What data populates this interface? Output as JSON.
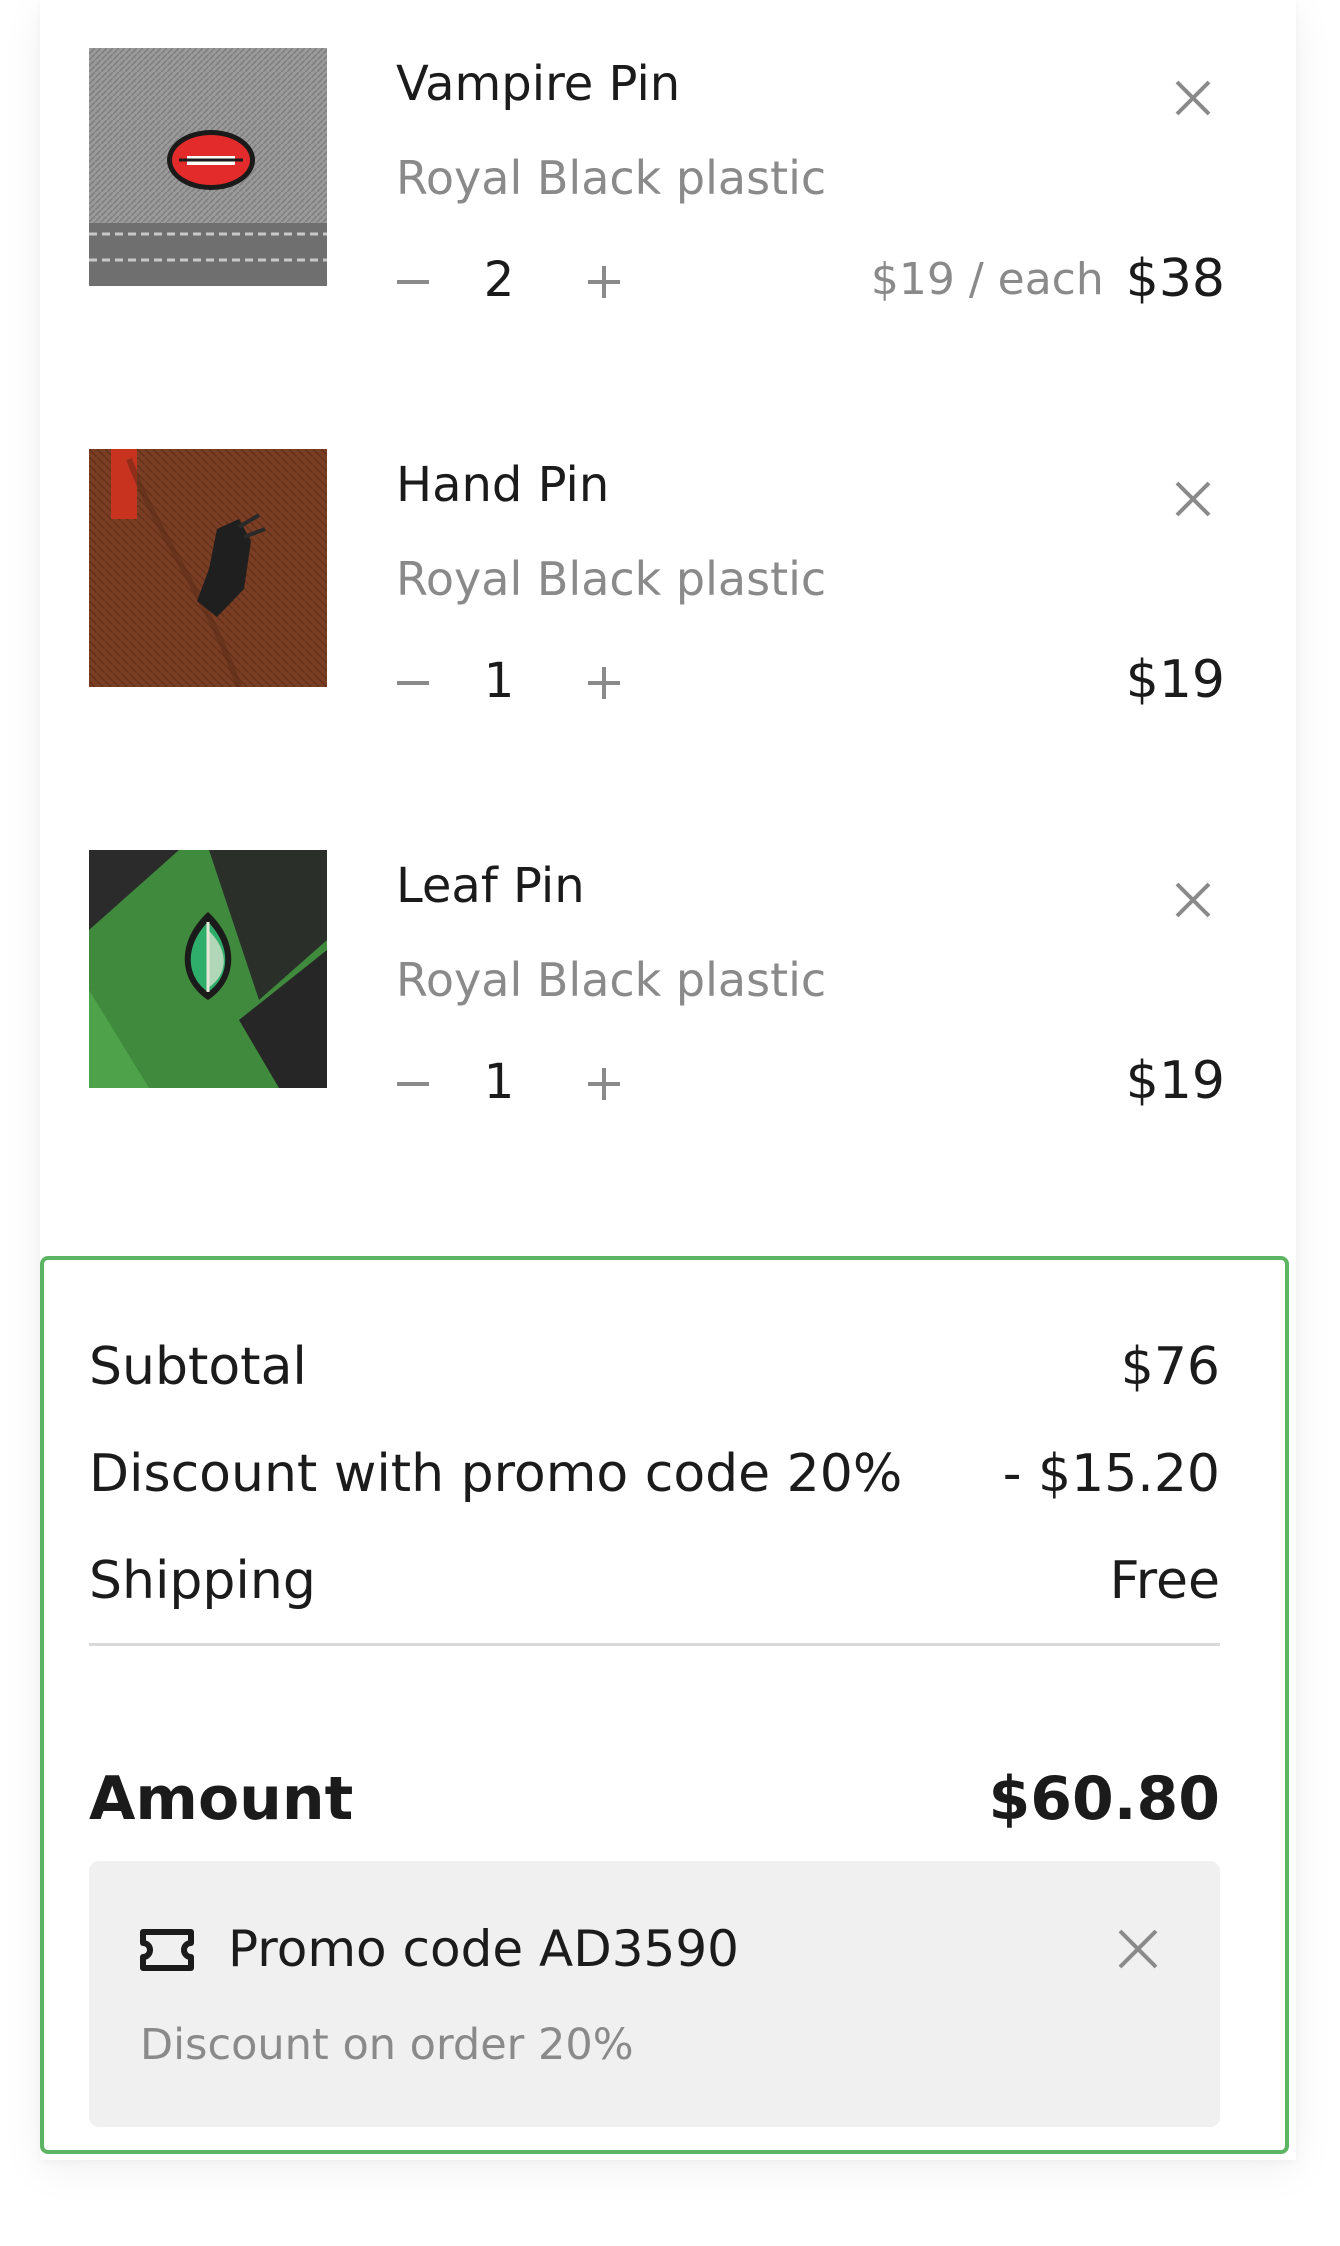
{
  "cart": {
    "items": [
      {
        "name": "Vampire Pin",
        "material": "Royal Black plastic",
        "quantity": "2",
        "unit_price": "$19 / each",
        "total": "$38",
        "image": "vampire-lips-pin-on-denim"
      },
      {
        "name": "Hand Pin",
        "material": "Royal Black plastic",
        "quantity": "1",
        "unit_price": "",
        "total": "$19",
        "image": "hand-pin-on-brown-fabric"
      },
      {
        "name": "Leaf Pin",
        "material": "Royal Black plastic",
        "quantity": "1",
        "unit_price": "",
        "total": "$19",
        "image": "leaf-pin-on-green-plaid"
      }
    ],
    "icons": {
      "minus": "minus-icon",
      "plus": "plus-icon",
      "remove": "close-icon"
    }
  },
  "summary": {
    "subtotal_label": "Subtotal",
    "subtotal_value": "$76",
    "discount_label": "Discount with promo code 20%",
    "discount_value": "- $15.20",
    "shipping_label": "Shipping",
    "shipping_value": "Free",
    "amount_label": "Amount",
    "amount_value": "$60.80",
    "accent_color": "#5cb562"
  },
  "promo": {
    "title": "Promo code AD3590",
    "subtitle": "Discount on order 20%",
    "icon": "ticket-icon"
  }
}
